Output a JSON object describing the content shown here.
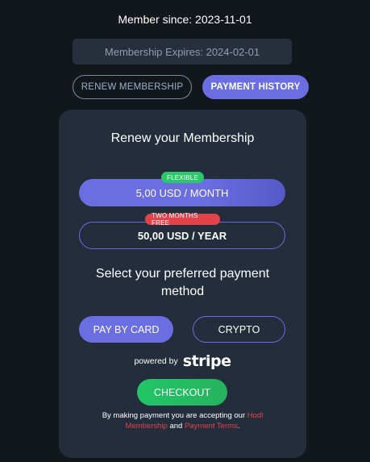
{
  "header": {
    "member_since": "Member since: 2023-11-01",
    "expires": "Membership Expires: 2024-02-01"
  },
  "tabs": [
    {
      "label": "RENEW MEMBERSHIP",
      "active": false
    },
    {
      "label": "PAYMENT HISTORY",
      "active": true
    }
  ],
  "card": {
    "title": "Renew your Membership",
    "plans": [
      {
        "badge": "FLEXIBLE",
        "badge_color": "#2ac86a",
        "price": "5,00 USD",
        "period": " / MONTH",
        "selected": true
      },
      {
        "badge": "TWO MONTHS FREE",
        "badge_color": "#e4424a",
        "price": "50,00 USD",
        "period": " / YEAR",
        "selected": false
      }
    ],
    "method_title": "Select your preferred payment method",
    "methods": [
      {
        "label": "PAY BY CARD",
        "selected": true
      },
      {
        "label": "CRYPTO",
        "selected": false
      }
    ],
    "powered_by": "powered by",
    "stripe_logo": "stripe",
    "checkout": "CHECKOUT",
    "terms": {
      "prefix": "By making payment you are accepting our ",
      "link1": "Hodl Membership",
      "middle": " and ",
      "link2": "Payment Terms",
      "suffix": "."
    }
  },
  "colors": {
    "background": "#12171c",
    "card": "#232d3b",
    "accent": "#6a6ee0",
    "success": "#2ac86a",
    "danger": "#e4424a"
  }
}
